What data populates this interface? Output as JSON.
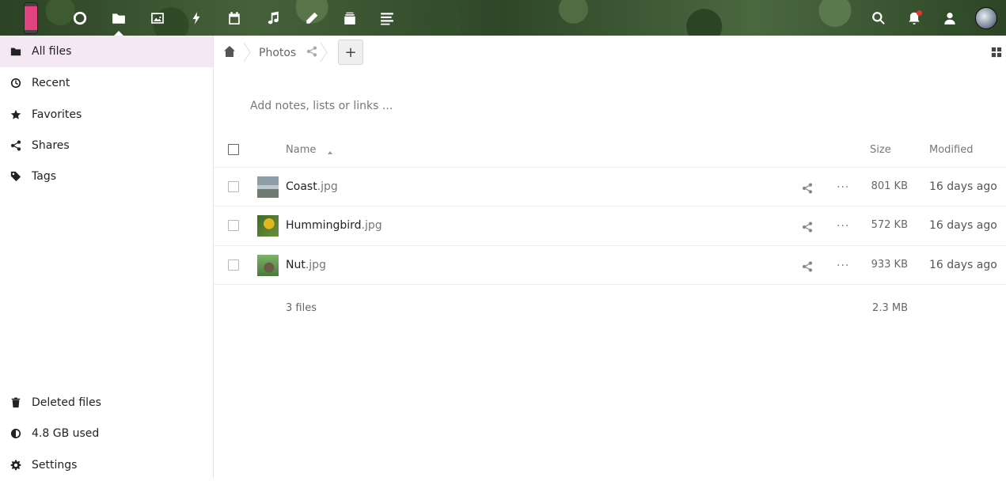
{
  "header": {
    "apps": [
      {
        "name": "dashboard",
        "icon": "circle-icon"
      },
      {
        "name": "files",
        "icon": "folder-icon"
      },
      {
        "name": "photos",
        "icon": "image-icon"
      },
      {
        "name": "activity",
        "icon": "lightning-icon"
      },
      {
        "name": "calendar",
        "icon": "calendar-icon"
      },
      {
        "name": "music",
        "icon": "music-icon"
      },
      {
        "name": "notes",
        "icon": "pencil-icon"
      },
      {
        "name": "deck",
        "icon": "stack-icon"
      },
      {
        "name": "text",
        "icon": "lines-icon"
      }
    ],
    "right_icons": [
      "search-icon",
      "bell-icon",
      "contacts-icon",
      "avatar"
    ],
    "notification_color": "#e9322d"
  },
  "sidebar": {
    "items": [
      {
        "label": "All files",
        "icon": "folder-icon",
        "active": true
      },
      {
        "label": "Recent",
        "icon": "clock-icon"
      },
      {
        "label": "Favorites",
        "icon": "star-icon"
      },
      {
        "label": "Shares",
        "icon": "share-icon"
      },
      {
        "label": "Tags",
        "icon": "tag-icon"
      }
    ],
    "footer": [
      {
        "label": "Deleted files",
        "icon": "trash-icon"
      },
      {
        "label": "4.8 GB used",
        "icon": "pie-icon"
      },
      {
        "label": "Settings",
        "icon": "gear-icon"
      }
    ],
    "active_color": "#f5e8f3"
  },
  "breadcrumb": {
    "folder": "Photos",
    "add_label": "+"
  },
  "notes_placeholder": "Add notes, lists or links ...",
  "table": {
    "columns": {
      "name": "Name",
      "size": "Size",
      "modified": "Modified"
    },
    "rows": [
      {
        "base": "Coast",
        "ext": ".jpg",
        "size": "801 KB",
        "modified": "16 days ago"
      },
      {
        "base": "Hummingbird",
        "ext": ".jpg",
        "size": "572 KB",
        "modified": "16 days ago"
      },
      {
        "base": "Nut",
        "ext": ".jpg",
        "size": "933 KB",
        "modified": "16 days ago"
      }
    ],
    "more_label": "···",
    "summary": {
      "count": "3 files",
      "size": "2.3 MB"
    }
  }
}
